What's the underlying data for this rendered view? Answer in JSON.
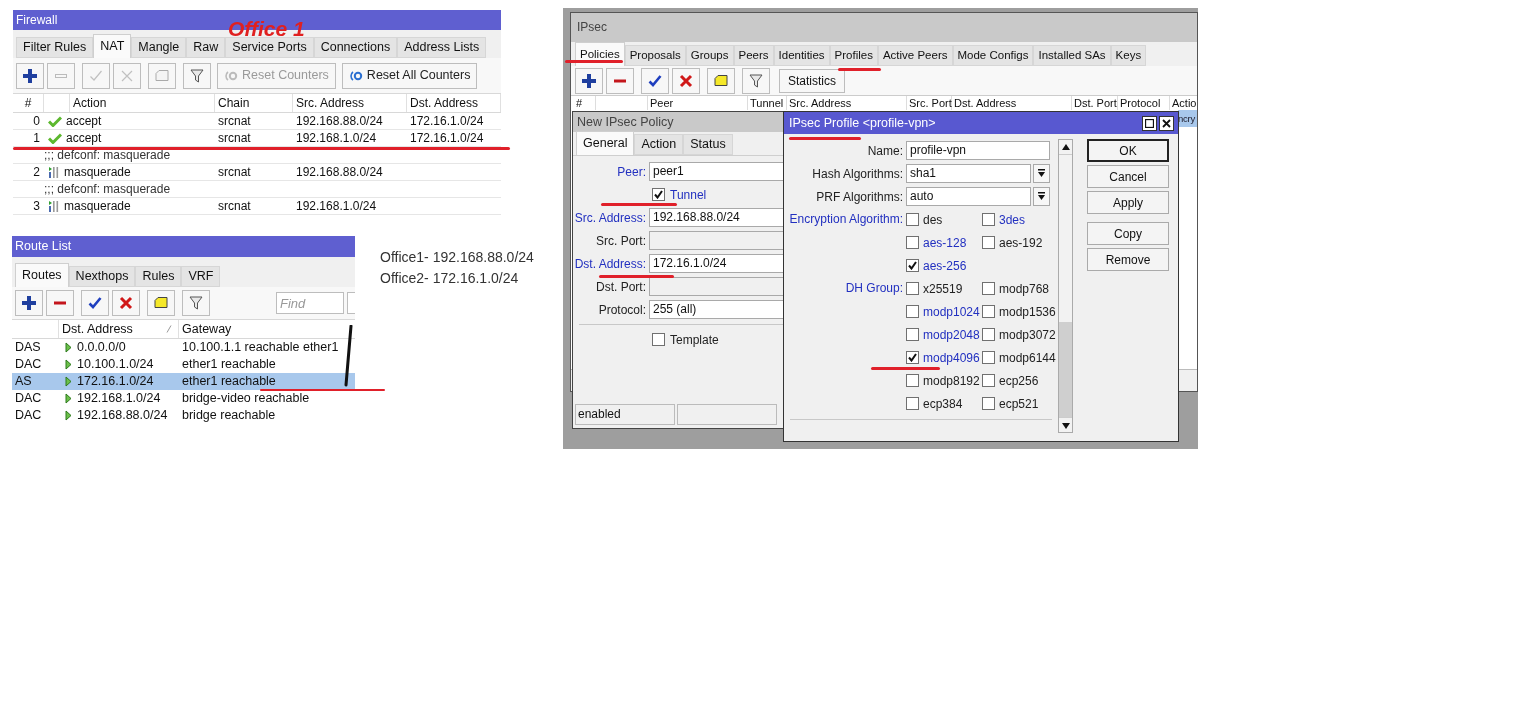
{
  "firewall": {
    "title": "Firewall",
    "annotation": "Office 1",
    "tabs": [
      {
        "label": "Filter Rules",
        "selected": false
      },
      {
        "label": "NAT",
        "selected": true
      },
      {
        "label": "Mangle",
        "selected": false
      },
      {
        "label": "Raw",
        "selected": false
      },
      {
        "label": "Service Ports",
        "selected": false
      },
      {
        "label": "Connections",
        "selected": false
      },
      {
        "label": "Address Lists",
        "selected": false
      }
    ],
    "tools": [
      {
        "kind": "add",
        "disabled": false
      },
      {
        "kind": "remove",
        "disabled": true
      },
      {
        "kind": "enable",
        "disabled": true
      },
      {
        "kind": "disable",
        "disabled": true
      },
      {
        "kind": "comment",
        "disabled": true
      },
      {
        "kind": "filter",
        "disabled": false
      }
    ],
    "buttons": [
      {
        "label": "Reset Counters",
        "disabled": true
      },
      {
        "label": "Reset All Counters",
        "disabled": false
      }
    ],
    "columns": [
      "#",
      "Action",
      "Chain",
      "Src. Address",
      "Dst. Address"
    ],
    "rows": [
      {
        "kind": "accept",
        "number": "0",
        "action": "accept",
        "chain": "srcnat",
        "src": "192.168.88.0/24",
        "dst": "172.16.1.0/24"
      },
      {
        "kind": "accept",
        "number": "1",
        "action": "accept",
        "chain": "srcnat",
        "src": "192.168.1.0/24",
        "dst": "172.16.1.0/24"
      },
      {
        "kind": "comment",
        "text": ";;; defconf: masquerade"
      },
      {
        "kind": "masquerade",
        "number": "2",
        "action": "masquerade",
        "chain": "srcnat",
        "src": "192.168.88.0/24"
      },
      {
        "kind": "comment",
        "text": ";;; defconf: masquerade"
      },
      {
        "kind": "masquerade",
        "number": "3",
        "action": "masquerade",
        "chain": "srcnat",
        "src": "192.168.1.0/24"
      }
    ]
  },
  "route_list": {
    "title": "Route List",
    "tabs": [
      {
        "label": "Routes",
        "selected": true
      },
      {
        "label": "Nexthops",
        "selected": false
      },
      {
        "label": "Rules",
        "selected": false
      },
      {
        "label": "VRF",
        "selected": false
      }
    ],
    "tools": [
      {
        "kind": "add",
        "disabled": false
      },
      {
        "kind": "remove",
        "disabled": false
      },
      {
        "kind": "enable",
        "disabled": false
      },
      {
        "kind": "disable",
        "disabled": false
      },
      {
        "kind": "comment",
        "disabled": false
      },
      {
        "kind": "filter",
        "disabled": false
      }
    ],
    "find_placeholder": "Find",
    "columns": [
      "Dst. Address",
      "Gateway"
    ],
    "rows": [
      {
        "flags": "DAS",
        "dst": "0.0.0.0/0",
        "gateway": "10.100.1.1 reachable ether1",
        "selected": false
      },
      {
        "flags": "DAC",
        "dst": "10.100.1.0/24",
        "gateway": "ether1 reachable",
        "selected": false
      },
      {
        "flags": "AS",
        "dst": "172.16.1.0/24",
        "gateway": "ether1 reachable",
        "selected": true
      },
      {
        "flags": "DAC",
        "dst": "192.168.1.0/24",
        "gateway": "bridge-video reachable",
        "selected": false
      },
      {
        "flags": "DAC",
        "dst": "192.168.88.0/24",
        "gateway": "bridge reachable",
        "selected": false
      }
    ]
  },
  "notes": [
    "Office1- 192.168.88.0/24",
    "Office2- 172.16.1.0/24"
  ],
  "ipsec": {
    "title": "IPsec",
    "tabs": [
      {
        "label": "Policies",
        "selected": true
      },
      {
        "label": "Proposals",
        "selected": false
      },
      {
        "label": "Groups",
        "selected": false
      },
      {
        "label": "Peers",
        "selected": false
      },
      {
        "label": "Identities",
        "selected": false
      },
      {
        "label": "Profiles",
        "selected": false
      },
      {
        "label": "Active Peers",
        "selected": false
      },
      {
        "label": "Mode Configs",
        "selected": false
      },
      {
        "label": "Installed SAs",
        "selected": false
      },
      {
        "label": "Keys",
        "selected": false
      }
    ],
    "tools": [
      {
        "kind": "add",
        "disabled": false
      },
      {
        "kind": "remove",
        "disabled": false
      },
      {
        "kind": "enable",
        "disabled": false
      },
      {
        "kind": "disable",
        "disabled": false
      },
      {
        "kind": "comment",
        "disabled": false
      },
      {
        "kind": "filter",
        "disabled": false
      }
    ],
    "statistics_button": "Statistics",
    "columns": [
      "#",
      "Peer",
      "Tunnel",
      "Src. Address",
      "Src. Port",
      "Dst. Address",
      "Dst. Port",
      "Protocol",
      "Actio"
    ],
    "rows": [
      {
        "action": "ncry",
        "selected": true
      }
    ]
  },
  "policy_dialog": {
    "title": "New IPsec Policy",
    "tabs": [
      {
        "label": "General",
        "selected": true
      },
      {
        "label": "Action",
        "selected": false
      },
      {
        "label": "Status",
        "selected": false
      }
    ],
    "fields": [
      {
        "kind": "text",
        "label": "Peer:",
        "value": "peer1",
        "link": true,
        "disabled": false
      },
      {
        "kind": "checkbox",
        "label": "Tunnel",
        "checked": true,
        "link": true
      },
      {
        "kind": "text",
        "label": "Src. Address:",
        "value": "192.168.88.0/24",
        "link": true,
        "disabled": false
      },
      {
        "kind": "text",
        "label": "Src. Port:",
        "link": false,
        "disabled": true
      },
      {
        "kind": "text",
        "label": "Dst. Address:",
        "value": "172.16.1.0/24",
        "link": true,
        "disabled": false
      },
      {
        "kind": "text",
        "label": "Dst. Port:",
        "link": false,
        "disabled": true
      },
      {
        "kind": "text",
        "label": "Protocol:",
        "value": "255 (all)",
        "link": false,
        "disabled": false
      },
      {
        "kind": "divider"
      },
      {
        "kind": "checkbox",
        "label": "Template",
        "checked": false,
        "link": false
      }
    ],
    "status": "enabled"
  },
  "profile_dialog": {
    "title": "IPsec Profile <profile-vpn>",
    "fields": [
      {
        "kind": "text",
        "label": "Name:",
        "value": "profile-vpn",
        "link": false
      },
      {
        "kind": "dropdown",
        "label": "Hash Algorithms:",
        "value": "sha1",
        "link": false
      },
      {
        "kind": "dropdown",
        "label": "PRF Algorithms:",
        "value": "auto",
        "link": false
      },
      {
        "kind": "options",
        "label": "Encryption Algorithm:",
        "link": true,
        "options": [
          {
            "label": "des",
            "checked": false,
            "link": false
          },
          {
            "label": "3des",
            "checked": false,
            "link": true
          },
          {
            "label": "aes-128",
            "checked": false,
            "link": true
          },
          {
            "label": "aes-192",
            "checked": false,
            "link": false
          },
          {
            "label": "aes-256",
            "checked": true,
            "link": true
          }
        ]
      },
      {
        "kind": "options",
        "label": "DH Group:",
        "link": true,
        "options": [
          {
            "label": "x25519",
            "checked": false,
            "link": false
          },
          {
            "label": "modp768",
            "checked": false,
            "link": false
          },
          {
            "label": "modp1024",
            "checked": false,
            "link": true
          },
          {
            "label": "modp1536",
            "checked": false,
            "link": false
          },
          {
            "label": "modp2048",
            "checked": false,
            "link": true
          },
          {
            "label": "modp3072",
            "checked": false,
            "link": false
          },
          {
            "label": "modp4096",
            "checked": true,
            "link": true
          },
          {
            "label": "modp6144",
            "checked": false,
            "link": false
          },
          {
            "label": "modp8192",
            "checked": false,
            "link": false
          },
          {
            "label": "ecp256",
            "checked": false,
            "link": false
          },
          {
            "label": "ecp384",
            "checked": false,
            "link": false
          },
          {
            "label": "ecp521",
            "checked": false,
            "link": false
          }
        ]
      }
    ],
    "button_groups": [
      [
        {
          "label": "OK",
          "default": true
        },
        {
          "label": "Cancel",
          "default": false
        },
        {
          "label": "Apply",
          "default": false
        }
      ],
      [
        {
          "label": "Copy",
          "default": false
        },
        {
          "label": "Remove",
          "default": false
        }
      ]
    ]
  }
}
